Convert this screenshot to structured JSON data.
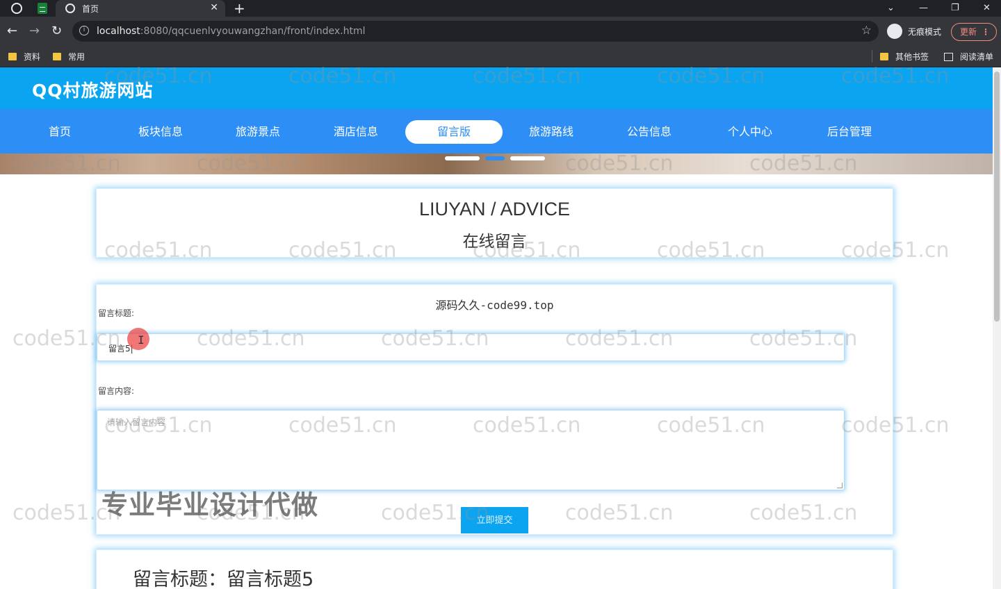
{
  "browser": {
    "tab_title": "首页",
    "tab_close": "✕",
    "new_tab": "+",
    "url_host": "localhost",
    "url_rest": ":8080/qqcuenlvyouwangzhan/front/index.html",
    "incognito_label": "无痕模式",
    "update_label": "更新",
    "bookmarks": [
      "资料",
      "常用"
    ],
    "bookmarks_right": [
      "其他书签",
      "阅读清单"
    ],
    "window_controls": [
      "⌄",
      "—",
      "❐",
      "✕"
    ]
  },
  "site": {
    "title": "QQ村旅游网站",
    "nav": [
      {
        "label": "首页",
        "active": false
      },
      {
        "label": "板块信息",
        "active": false
      },
      {
        "label": "旅游景点",
        "active": false
      },
      {
        "label": "酒店信息",
        "active": false
      },
      {
        "label": "留言版",
        "active": true
      },
      {
        "label": "旅游路线",
        "active": false
      },
      {
        "label": "公告信息",
        "active": false
      },
      {
        "label": "个人中心",
        "active": false
      },
      {
        "label": "后台管理",
        "active": false
      }
    ],
    "accent_color": "#2d8ef5",
    "header_color": "#0aa4f0"
  },
  "heading": {
    "en": "LIUYAN / ADVICE",
    "cn": "在线留言"
  },
  "form": {
    "source_note": "源码久久-code99.top",
    "title_label": "留言标题:",
    "title_value": "留言5|",
    "content_label": "留言内容:",
    "content_placeholder": "请输入留言内容",
    "submit_label": "立即提交"
  },
  "message": {
    "title": "留言标题：留言标题5"
  },
  "overlays": {
    "watermark": "code51.cn",
    "promo": "专业毕业设计代做"
  }
}
